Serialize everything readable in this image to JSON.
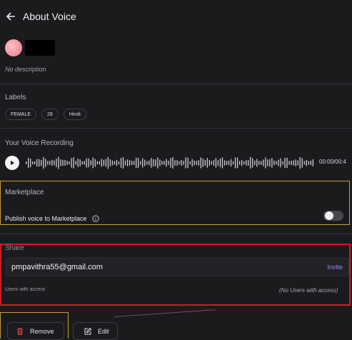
{
  "header": {
    "title": "About Voice",
    "back_icon": "arrow-left-icon"
  },
  "voice": {
    "description": "No description"
  },
  "labels": {
    "heading": "Labels",
    "chips": [
      "FEMALE",
      "28",
      "Hindi"
    ]
  },
  "recording": {
    "heading": "Your Voice Recording",
    "time": "00:00/00:4",
    "play_icon": "play-icon"
  },
  "marketplace": {
    "heading": "Marketplace",
    "publish_label": "Publish voice to Marketplace",
    "info_icon": "info-icon",
    "publish_enabled": false
  },
  "share": {
    "heading": "Share",
    "email": "pmpavithra55@gmail.com",
    "invite_label": "Invite",
    "access_label": "Users with access",
    "access_value": "(No Users with access)"
  },
  "actions": {
    "remove_label": "Remove",
    "edit_label": "Edit"
  },
  "colors": {
    "background": "#1b1b1e",
    "accent": "#9b8cff",
    "remove_icon": "#e0474b",
    "highlight_yellow": "#c9a227",
    "highlight_red": "#c82020"
  }
}
